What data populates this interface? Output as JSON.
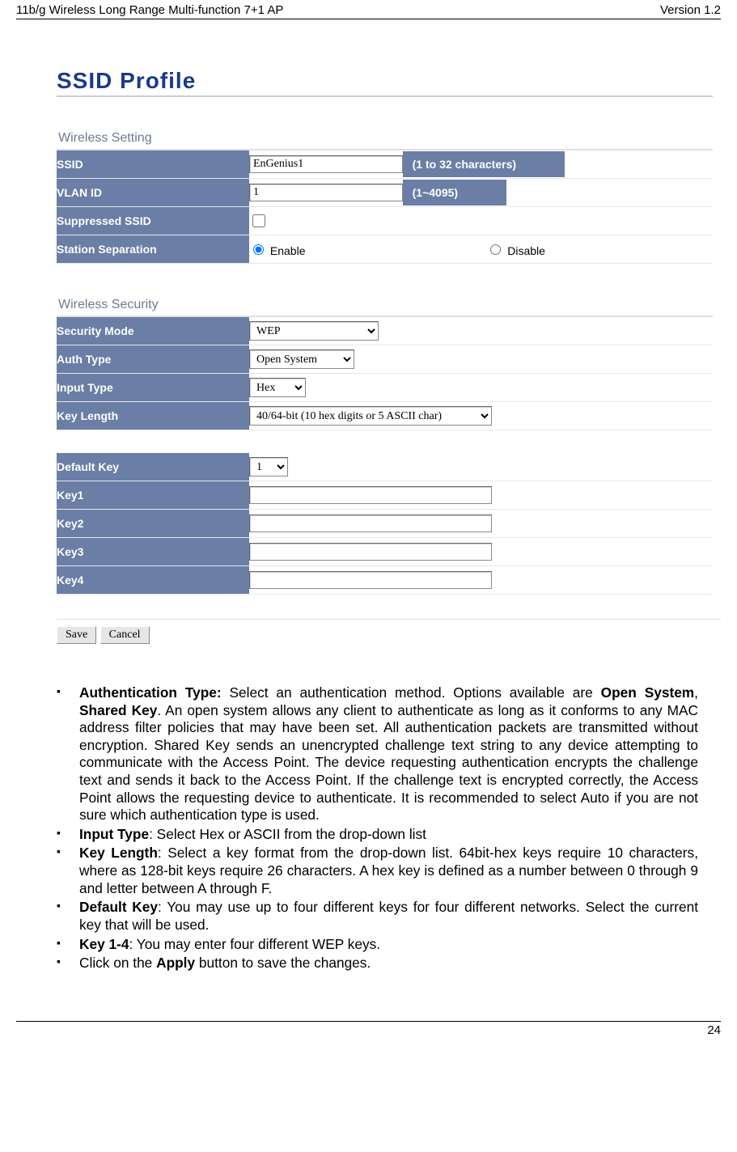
{
  "header": {
    "left": "11b/g Wireless Long Range Multi-function 7+1 AP",
    "right": "Version 1.2"
  },
  "title": "SSID Profile",
  "wireless_setting": {
    "heading": "Wireless Setting",
    "rows": {
      "ssid": {
        "label": "SSID",
        "value": "EnGenius1",
        "hint": "(1 to 32 characters)"
      },
      "vlan": {
        "label": "VLAN ID",
        "value": "1",
        "hint": "(1~4095)"
      },
      "supp": {
        "label": "Suppressed SSID",
        "checked": false
      },
      "sep": {
        "label": "Station Separation",
        "enable": "Enable",
        "disable": "Disable",
        "selected": "enable"
      }
    }
  },
  "wireless_security": {
    "heading": "Wireless Security",
    "rows": {
      "mode": {
        "label": "Security Mode",
        "value": "WEP"
      },
      "auth": {
        "label": "Auth Type",
        "value": "Open System"
      },
      "input": {
        "label": "Input Type",
        "value": "Hex"
      },
      "keylen": {
        "label": "Key Length",
        "value": "40/64-bit (10 hex digits or 5 ASCII char)"
      }
    }
  },
  "keys": {
    "default": {
      "label": "Default Key",
      "value": "1"
    },
    "k1": {
      "label": "Key1",
      "value": ""
    },
    "k2": {
      "label": "Key2",
      "value": ""
    },
    "k3": {
      "label": "Key3",
      "value": ""
    },
    "k4": {
      "label": "Key4",
      "value": ""
    }
  },
  "buttons": {
    "save": "Save",
    "cancel": "Cancel"
  },
  "notes": {
    "auth_b": "Authentication Type:",
    "auth_t1": " Select an authentication method. Options available are ",
    "auth_b2": "Open System",
    "auth_c1": ", ",
    "auth_b3": "Shared Key",
    "auth_t2": ". An open system allows any client to authenticate as long as it conforms to any MAC address filter policies that may have been set. All authentication packets are transmitted without encryption. Shared Key sends an unencrypted challenge text string to any device attempting to communicate with the Access Point. The device requesting authentication encrypts the challenge text and sends it back to the Access Point. If the challenge text is encrypted correctly, the Access Point allows the requesting device to authenticate. It is recommended to select Auto if you are not sure which authentication type is used.",
    "it_b": "Input Type",
    "it_t": ": Select Hex or ASCII from the drop-down list",
    "kl_b": "Key Length",
    "kl_t": ": Select a key format from the drop-down list. 64bit-hex keys require 10 characters, where as 128-bit keys require 26 characters. A hex key is defined as a number between 0 through 9 and letter between A through F.",
    "dk_b": "Default Key",
    "dk_t": ": You may use up to four different keys for four different networks. Select the current key that will be used.",
    "k14_b": "Key 1-4",
    "k14_t": ": You may enter four different WEP keys.",
    "ap_t1": "Click on the ",
    "ap_b": "Apply",
    "ap_t2": " button to save the changes."
  },
  "footer": {
    "page": "24"
  }
}
